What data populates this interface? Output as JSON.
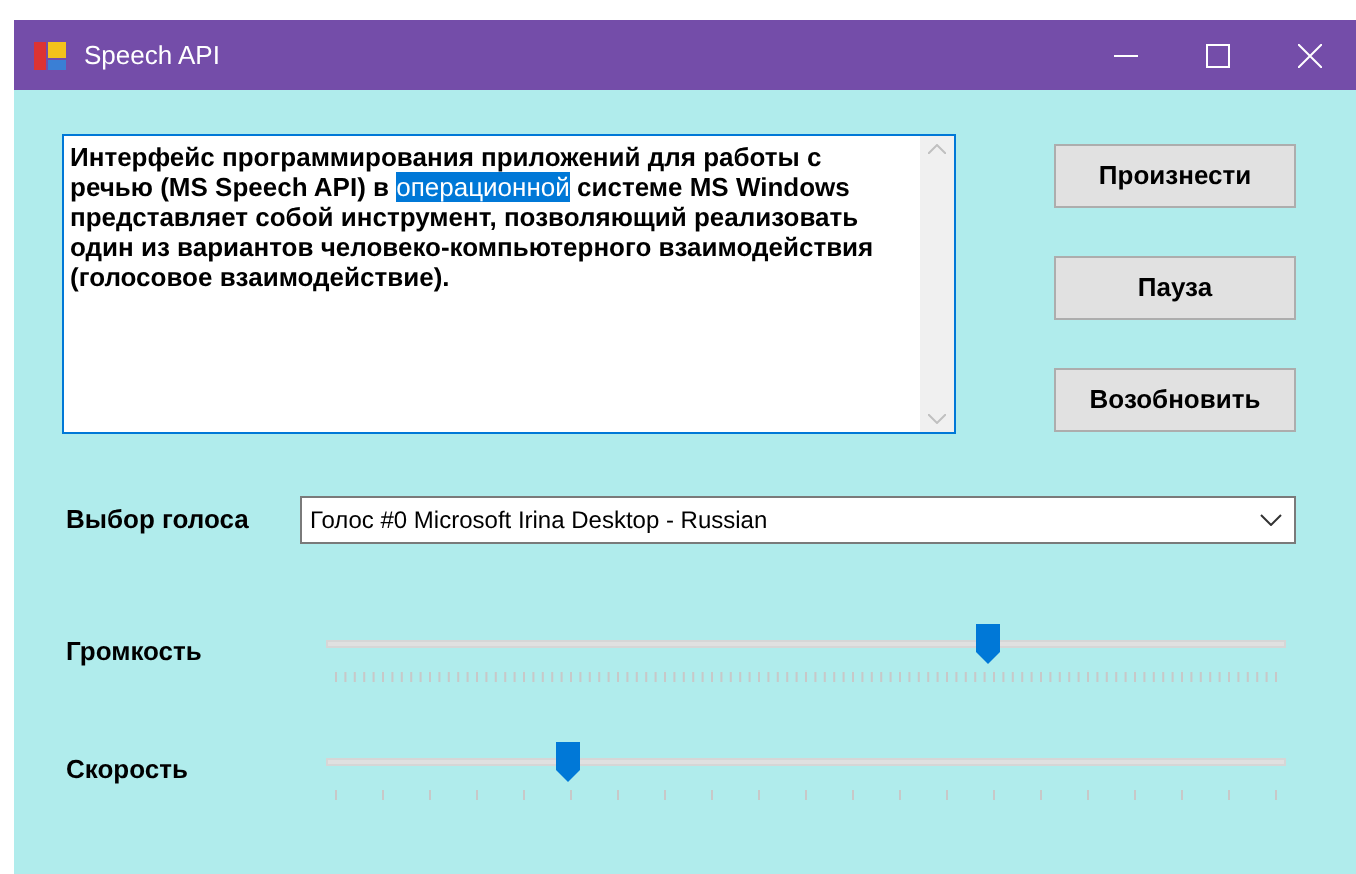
{
  "window": {
    "title": "Speech API"
  },
  "text_box": {
    "parts": [
      {
        "text": "Интерфейс программирования приложений для работы с речью (MS Speech API) в ",
        "selected": false
      },
      {
        "text": "операционной",
        "selected": true
      },
      {
        "text": " системе MS Windows представляет собой инструмент, позволяющий реализовать один из вариантов человеко-компьютерного взаимодействия (голосовое взаимодействие).",
        "selected": false
      }
    ]
  },
  "buttons": [
    "Произнести",
    "Пауза",
    "Возобновить"
  ],
  "voice": {
    "label": "Выбор голоса",
    "value": "Голос #0 Microsoft Irina Desktop - Russian"
  },
  "sliders": [
    {
      "label": "Громкость",
      "level": 0.69,
      "kind": "fine"
    },
    {
      "label": "Скорость",
      "level": 0.25,
      "kind": "coarse"
    }
  ]
}
